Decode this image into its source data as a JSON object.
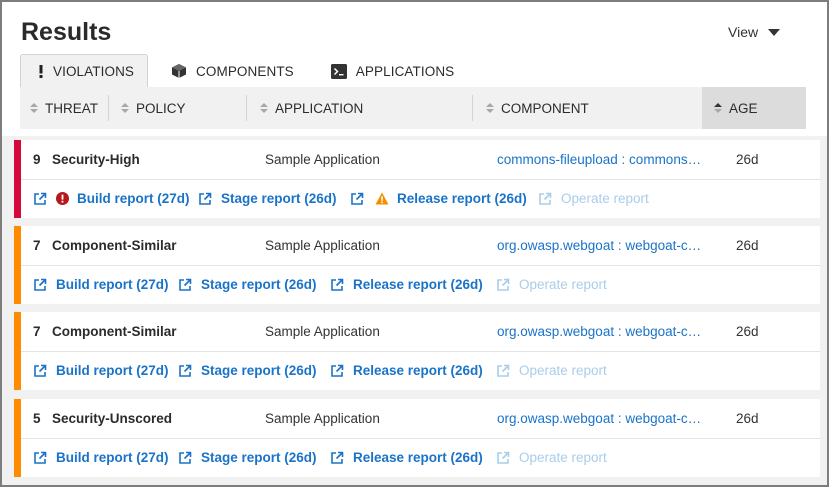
{
  "page": {
    "title": "Results",
    "view_label": "View"
  },
  "tabs": [
    {
      "label": "VIOLATIONS",
      "icon": "exclamation-icon",
      "active": true
    },
    {
      "label": "COMPONENTS",
      "icon": "cube-icon",
      "active": false
    },
    {
      "label": "APPLICATIONS",
      "icon": "terminal-icon",
      "active": false
    }
  ],
  "columns": {
    "threat": "THREAT",
    "policy": "POLICY",
    "application": "APPLICATION",
    "component": "COMPONENT",
    "age": "AGE"
  },
  "colors": {
    "critical": "#d6083b",
    "severe": "#ff8c00",
    "link": "#1a73c8",
    "link_disabled": "#a9cdea"
  },
  "violations": [
    {
      "threat": "9",
      "policy": "Security-High",
      "application": "Sample Application",
      "component": "commons-fileupload : commons…",
      "age": "26d",
      "reports": {
        "build": "Build report (27d)",
        "stage": "Stage report (26d)",
        "release": "Release report (26d)",
        "operate": "Operate report"
      }
    },
    {
      "threat": "7",
      "policy": "Component-Similar",
      "application": "Sample Application",
      "component": "org.owasp.webgoat : webgoat-c…",
      "age": "26d",
      "reports": {
        "build": "Build report (27d)",
        "stage": "Stage report (26d)",
        "release": "Release report (26d)",
        "operate": "Operate report"
      }
    },
    {
      "threat": "7",
      "policy": "Component-Similar",
      "application": "Sample Application",
      "component": "org.owasp.webgoat : webgoat-c…",
      "age": "26d",
      "reports": {
        "build": "Build report (27d)",
        "stage": "Stage report (26d)",
        "release": "Release report (26d)",
        "operate": "Operate report"
      }
    },
    {
      "threat": "5",
      "policy": "Security-Unscored",
      "application": "Sample Application",
      "component": "org.owasp.webgoat : webgoat-c…",
      "age": "26d",
      "reports": {
        "build": "Build report (27d)",
        "stage": "Stage report (26d)",
        "release": "Release report (26d)",
        "operate": "Operate report"
      }
    }
  ]
}
